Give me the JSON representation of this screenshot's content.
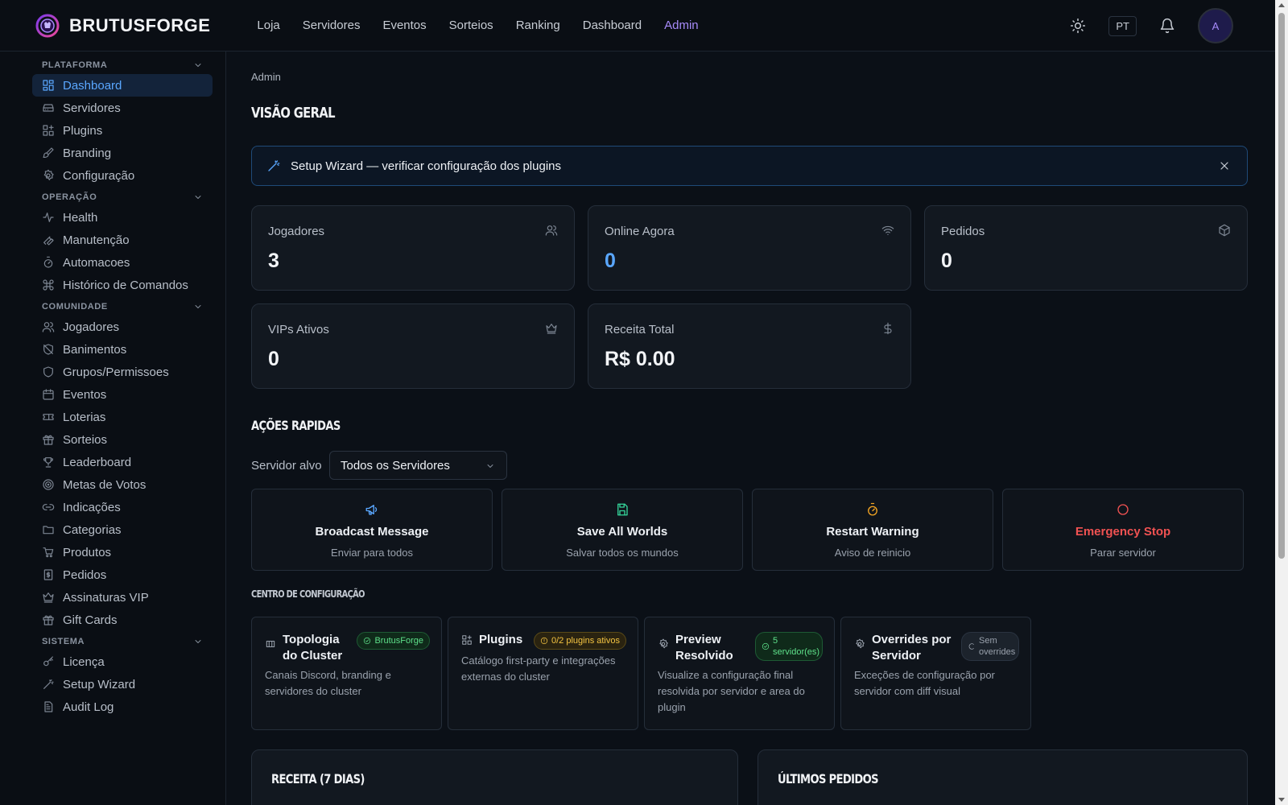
{
  "brand": {
    "name": "BRUTUSFORGE"
  },
  "nav": [
    {
      "label": "Loja",
      "active": false
    },
    {
      "label": "Servidores",
      "active": false
    },
    {
      "label": "Eventos",
      "active": false
    },
    {
      "label": "Sorteios",
      "active": false
    },
    {
      "label": "Ranking",
      "active": false
    },
    {
      "label": "Dashboard",
      "active": false
    },
    {
      "label": "Admin",
      "active": true
    }
  ],
  "header": {
    "language": "PT",
    "avatar_initial": "A"
  },
  "sidebar": {
    "sections": [
      {
        "title": "PLATAFORMA",
        "items": [
          {
            "label": "Dashboard",
            "icon": "dashboard-icon",
            "active": true
          },
          {
            "label": "Servidores",
            "icon": "server-icon"
          },
          {
            "label": "Plugins",
            "icon": "plugin-icon"
          },
          {
            "label": "Branding",
            "icon": "brush-icon"
          },
          {
            "label": "Configuração",
            "icon": "gear-icon"
          }
        ]
      },
      {
        "title": "OPERAÇÃO",
        "items": [
          {
            "label": "Health",
            "icon": "activity-icon"
          },
          {
            "label": "Manutenção",
            "icon": "wrench-icon"
          },
          {
            "label": "Automacoes",
            "icon": "timer-icon"
          },
          {
            "label": "Histórico de Comandos",
            "icon": "command-icon"
          }
        ]
      },
      {
        "title": "COMUNIDADE",
        "items": [
          {
            "label": "Jogadores",
            "icon": "users-icon"
          },
          {
            "label": "Banimentos",
            "icon": "ban-icon"
          },
          {
            "label": "Grupos/Permissoes",
            "icon": "shield-icon"
          },
          {
            "label": "Eventos",
            "icon": "calendar-icon"
          },
          {
            "label": "Loterias",
            "icon": "ticket-icon"
          },
          {
            "label": "Sorteios",
            "icon": "gift-icon"
          },
          {
            "label": "Leaderboard",
            "icon": "trophy-icon"
          },
          {
            "label": "Metas de Votos",
            "icon": "target-icon"
          },
          {
            "label": "Indicações",
            "icon": "link-icon"
          },
          {
            "label": "Categorias",
            "icon": "folder-icon"
          },
          {
            "label": "Produtos",
            "icon": "cart-icon"
          },
          {
            "label": "Pedidos",
            "icon": "receipt-icon"
          },
          {
            "label": "Assinaturas VIP",
            "icon": "crown-icon"
          },
          {
            "label": "Gift Cards",
            "icon": "gift-icon"
          }
        ]
      },
      {
        "title": "SISTEMA",
        "items": [
          {
            "label": "Licença",
            "icon": "key-icon"
          },
          {
            "label": "Setup Wizard",
            "icon": "wand-icon"
          },
          {
            "label": "Audit Log",
            "icon": "file-icon"
          }
        ]
      }
    ]
  },
  "main": {
    "breadcrumb": "Admin",
    "title": "VISÃO GERAL",
    "wizard_banner": "Setup Wizard — verificar configuração dos plugins",
    "stats": [
      {
        "label": "Jogadores",
        "value": "3",
        "icon": "users-icon"
      },
      {
        "label": "Online Agora",
        "value": "0",
        "icon": "wifi-icon",
        "accent": true
      },
      {
        "label": "Pedidos",
        "value": "0",
        "icon": "package-icon"
      },
      {
        "label": "VIPs Ativos",
        "value": "0",
        "icon": "crown-icon"
      },
      {
        "label": "Receita Total",
        "value": "R$ 0.00",
        "icon": "dollar-icon"
      }
    ],
    "quick_actions": {
      "title": "AÇÕES RAPIDAS",
      "target_label": "Servidor alvo",
      "target_value": "Todos os Servidores",
      "actions": [
        {
          "title": "Broadcast Message",
          "subtitle": "Enviar para todos",
          "icon": "megaphone-icon",
          "color": "#5aa7ff"
        },
        {
          "title": "Save All Worlds",
          "subtitle": "Salvar todos os mundos",
          "icon": "save-icon",
          "color": "#34d399"
        },
        {
          "title": "Restart Warning",
          "subtitle": "Aviso de reinicio",
          "icon": "timer-icon",
          "color": "#f5a623"
        },
        {
          "title": "Emergency Stop",
          "subtitle": "Parar servidor",
          "icon": "stop-icon",
          "color": "#f05252"
        }
      ]
    },
    "config_center": {
      "title": "CENTRO DE CONFIGURAÇÃO",
      "cards": [
        {
          "name": "Topologia do Cluster",
          "badge": "BrutusForge",
          "badge_style": "green",
          "description": "Canais Discord, branding e servidores do cluster",
          "icon": "cluster-icon"
        },
        {
          "name": "Plugins",
          "badge": "0/2 plugins ativos",
          "badge_style": "yellow",
          "description": "Catálogo first-party e integrações externas do cluster",
          "icon": "plugin-icon"
        },
        {
          "name": "Preview Resolvido",
          "badge": "5 servidor(es)",
          "badge_style": "green",
          "description": "Visualize a configuração final resolvida por servidor e area do plugin",
          "icon": "gear-icon"
        },
        {
          "name": "Overrides por Servidor",
          "badge": "Sem overrides",
          "badge_style": "gray",
          "description": "Exceções de configuração por servidor com diff visual",
          "icon": "gear-icon"
        }
      ]
    },
    "revenue_title": "RECEITA (7 DIAS)",
    "orders_title": "ÚLTIMOS PEDIDOS"
  }
}
